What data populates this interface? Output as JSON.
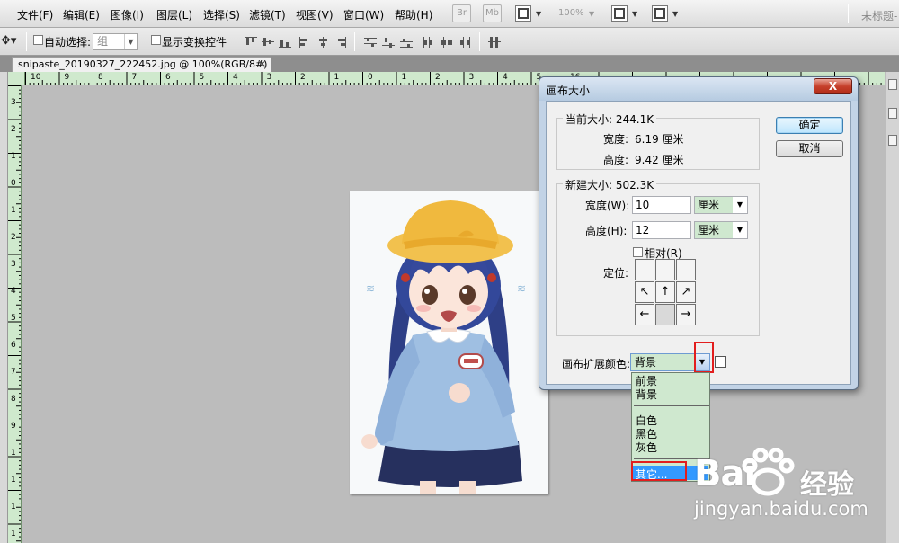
{
  "menubar": {
    "items": [
      "文件(F)",
      "编辑(E)",
      "图像(I)",
      "图层(L)",
      "选择(S)",
      "滤镜(T)",
      "视图(V)",
      "窗口(W)",
      "帮助(H)"
    ],
    "bridge_label": "Br",
    "mini_bridge_label": "Mb",
    "zoom_level": "100%",
    "doc_title": "未标题-"
  },
  "options_bar": {
    "auto_select_label": "自动选择:",
    "auto_select_value": "组",
    "show_transform_label": "显示变换控件"
  },
  "document": {
    "tab_label": "snipaste_20190327_222452.jpg @ 100%(RGB/8#) *",
    "tab_close": "×"
  },
  "rulers": {
    "top_labels": [
      "10",
      "9",
      "8",
      "7",
      "6",
      "5",
      "4",
      "3",
      "2",
      "1",
      "0",
      "1",
      "2",
      "3",
      "4",
      "5",
      "16"
    ],
    "left_labels": [
      "3",
      "2",
      "1",
      "0",
      "1",
      "2",
      "3",
      "4",
      "5",
      "6",
      "7",
      "8",
      "9",
      "1",
      "1",
      "1",
      "1"
    ]
  },
  "dialog": {
    "title": "画布大小",
    "close_label": "X",
    "ok_label": "确定",
    "cancel_label": "取消",
    "current_size": {
      "title": "当前大小: 244.1K",
      "width_label": "宽度:",
      "width_value": "6.19 厘米",
      "height_label": "高度:",
      "height_value": "9.42 厘米"
    },
    "new_size": {
      "title": "新建大小: 502.3K",
      "width_label": "宽度(W):",
      "width_value": "10",
      "width_unit": "厘米",
      "height_label": "高度(H):",
      "height_value": "12",
      "height_unit": "厘米",
      "relative_label": "相对(R)",
      "anchor_label": "定位:",
      "anchor_arrows": [
        "↖",
        "↑",
        "↗",
        "←",
        "",
        "→"
      ]
    },
    "ext_color_label": "画布扩展颜色:",
    "ext_color_value": "背景"
  },
  "color_dropdown": {
    "items": [
      "前景",
      "背景",
      "白色",
      "黑色",
      "灰色",
      "其它..."
    ]
  },
  "watermark": {
    "logo": "Bai",
    "name": "经验",
    "url": "jingyan.baidu.com"
  },
  "colors": {
    "ruler_bg": "#cfe9cd",
    "dropdown_bg": "#cfe8cf",
    "highlight": "#e21e1e",
    "selection": "#3399ff"
  }
}
